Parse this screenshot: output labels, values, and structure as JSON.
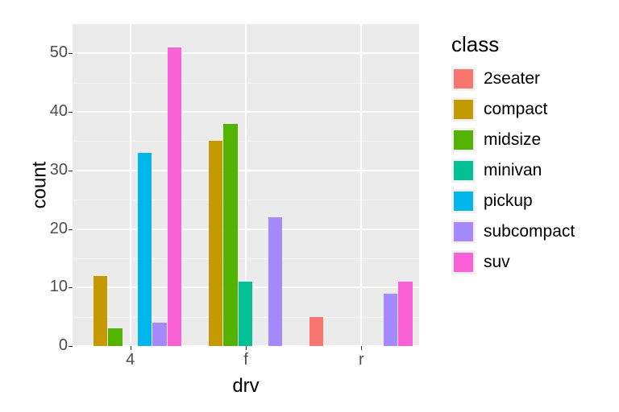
{
  "chart_data": {
    "type": "bar",
    "title": "",
    "xlabel": "drv",
    "ylabel": "count",
    "categories": [
      "4",
      "f",
      "r"
    ],
    "ylim": [
      0,
      55
    ],
    "y_ticks": [
      0,
      10,
      20,
      30,
      40,
      50
    ],
    "legend_title": "class",
    "series": [
      {
        "name": "2seater",
        "color": "#F8766D",
        "values": [
          0,
          0,
          5
        ]
      },
      {
        "name": "compact",
        "color": "#C49A00",
        "values": [
          12,
          35,
          0
        ]
      },
      {
        "name": "midsize",
        "color": "#53B400",
        "values": [
          3,
          38,
          0
        ]
      },
      {
        "name": "minivan",
        "color": "#00C094",
        "values": [
          0,
          11,
          0
        ]
      },
      {
        "name": "pickup",
        "color": "#00B6EB",
        "values": [
          33,
          0,
          0
        ]
      },
      {
        "name": "subcompact",
        "color": "#A58AFF",
        "values": [
          4,
          22,
          9
        ]
      },
      {
        "name": "suv",
        "color": "#FB61D7",
        "values": [
          51,
          0,
          11
        ]
      }
    ]
  }
}
